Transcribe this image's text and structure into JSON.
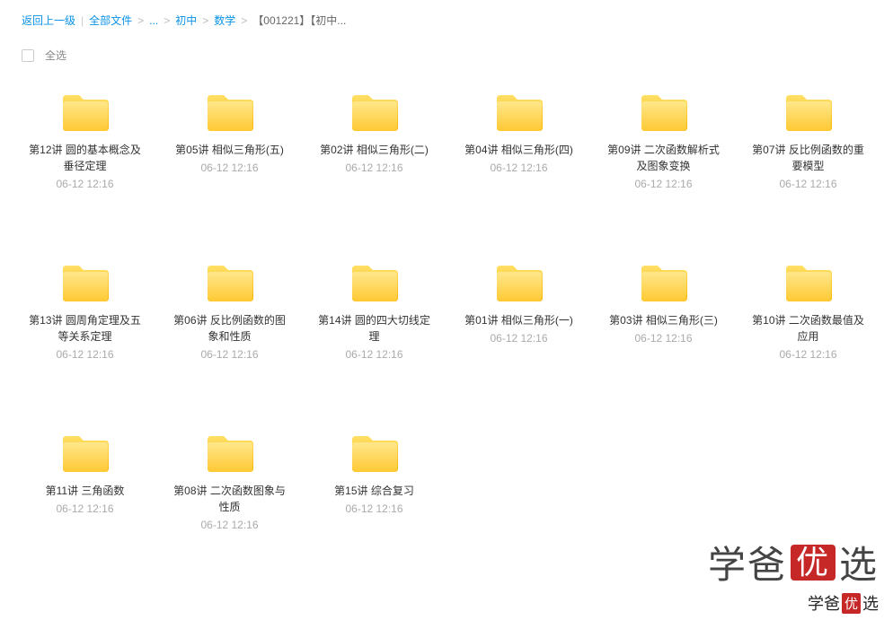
{
  "breadcrumb": {
    "back": "返回上一级",
    "all_files": "全部文件",
    "ellipsis": "...",
    "level1": "初中",
    "level2": "数学",
    "level3": "【001221】【初中..."
  },
  "select_all": {
    "label": "全选"
  },
  "folders": [
    {
      "name": "第12讲 圆的基本概念及垂径定理",
      "date": "06-12 12:16"
    },
    {
      "name": "第05讲 相似三角形(五)",
      "date": "06-12 12:16"
    },
    {
      "name": "第02讲 相似三角形(二)",
      "date": "06-12 12:16"
    },
    {
      "name": "第04讲 相似三角形(四)",
      "date": "06-12 12:16"
    },
    {
      "name": "第09讲 二次函数解析式及图象变换",
      "date": "06-12 12:16"
    },
    {
      "name": "第07讲 反比例函数的重要模型",
      "date": "06-12 12:16"
    },
    {
      "name": "第13讲 圆周角定理及五等关系定理",
      "date": "06-12 12:16"
    },
    {
      "name": "第06讲 反比例函数的图象和性质",
      "date": "06-12 12:16"
    },
    {
      "name": "第14讲 圆的四大切线定理",
      "date": "06-12 12:16"
    },
    {
      "name": "第01讲 相似三角形(一)",
      "date": "06-12 12:16"
    },
    {
      "name": "第03讲 相似三角形(三)",
      "date": "06-12 12:16"
    },
    {
      "name": "第10讲 二次函数最值及应用",
      "date": "06-12 12:16"
    },
    {
      "name": "第11讲 三角函数",
      "date": "06-12 12:16"
    },
    {
      "name": "第08讲 二次函数图象与性质",
      "date": "06-12 12:16"
    },
    {
      "name": "第15讲 综合复习",
      "date": "06-12 12:16"
    }
  ],
  "watermark": {
    "prefix": "学爸",
    "stamp": "优",
    "suffix": "选"
  }
}
